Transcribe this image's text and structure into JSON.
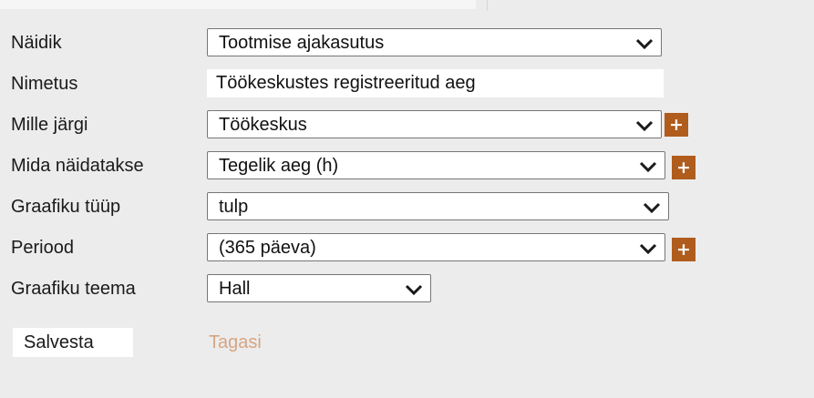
{
  "form": {
    "fields": [
      {
        "label": "Näidik",
        "value": "Tootmise ajakasutus",
        "type": "select",
        "has_add": false
      },
      {
        "label": "Nimetus",
        "value": "Töökeskustes registreeritud aeg",
        "type": "text",
        "has_add": false
      },
      {
        "label": "Mille järgi",
        "value": "Töökeskus",
        "type": "select",
        "has_add": true
      },
      {
        "label": "Mida näidatakse",
        "value": "Tegelik aeg (h)",
        "type": "select",
        "has_add": true
      },
      {
        "label": "Graafiku tüüp",
        "value": "tulp",
        "type": "select",
        "has_add": false
      },
      {
        "label": "Periood",
        "value": "(365 päeva)",
        "type": "select",
        "has_add": true
      },
      {
        "label": "Graafiku teema",
        "value": "Hall",
        "type": "select",
        "has_add": false
      }
    ],
    "add_button_label": "+",
    "save_label": "Salvesta",
    "back_label": "Tagasi"
  },
  "colors": {
    "background": "#ececec",
    "add_button": "#b05c1c",
    "back_link": "#d5a683"
  },
  "icons": {
    "dropdown": "chevron-down-icon",
    "add": "plus-icon"
  }
}
